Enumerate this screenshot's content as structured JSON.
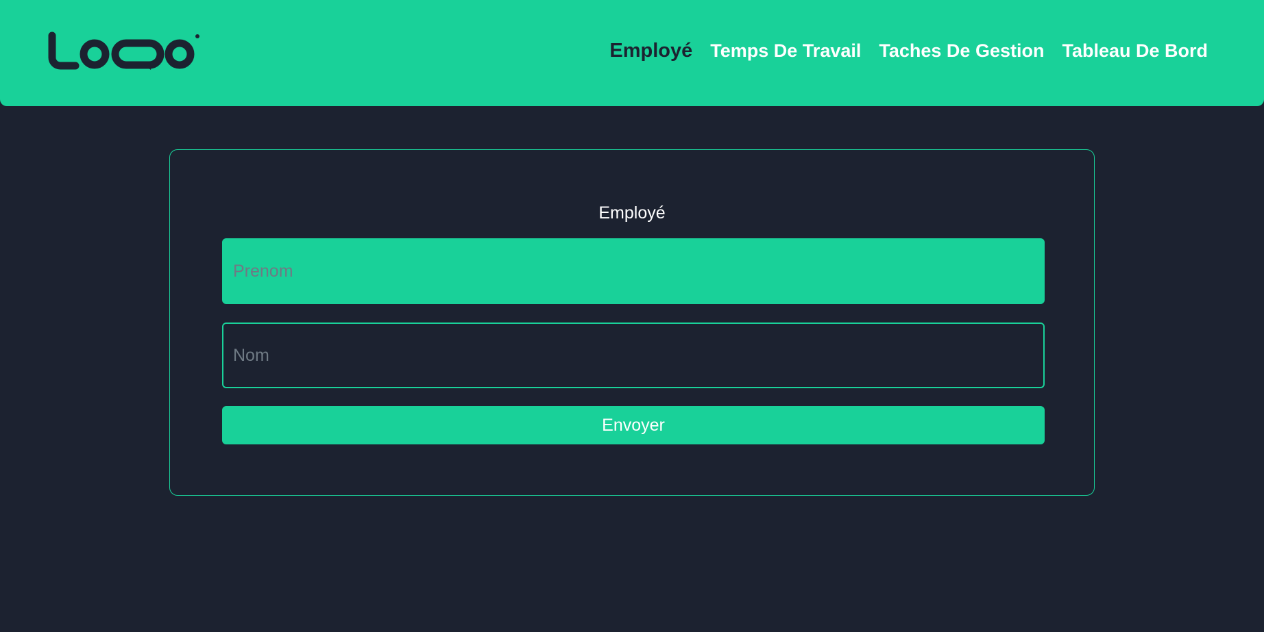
{
  "header": {
    "logo_icon": "logo-mark",
    "nav": [
      {
        "label": "Employé",
        "active": true
      },
      {
        "label": "Temps De Travail",
        "active": false
      },
      {
        "label": "Taches De Gestion",
        "active": false
      },
      {
        "label": "Tableau De Bord",
        "active": false
      }
    ]
  },
  "form": {
    "title": "Employé",
    "prenom": {
      "placeholder": "Prenom",
      "value": ""
    },
    "nom": {
      "placeholder": "Nom",
      "value": ""
    },
    "submit_label": "Envoyer"
  },
  "colors": {
    "accent": "#19d199",
    "background": "#1c2230",
    "text": "#ffffff"
  }
}
